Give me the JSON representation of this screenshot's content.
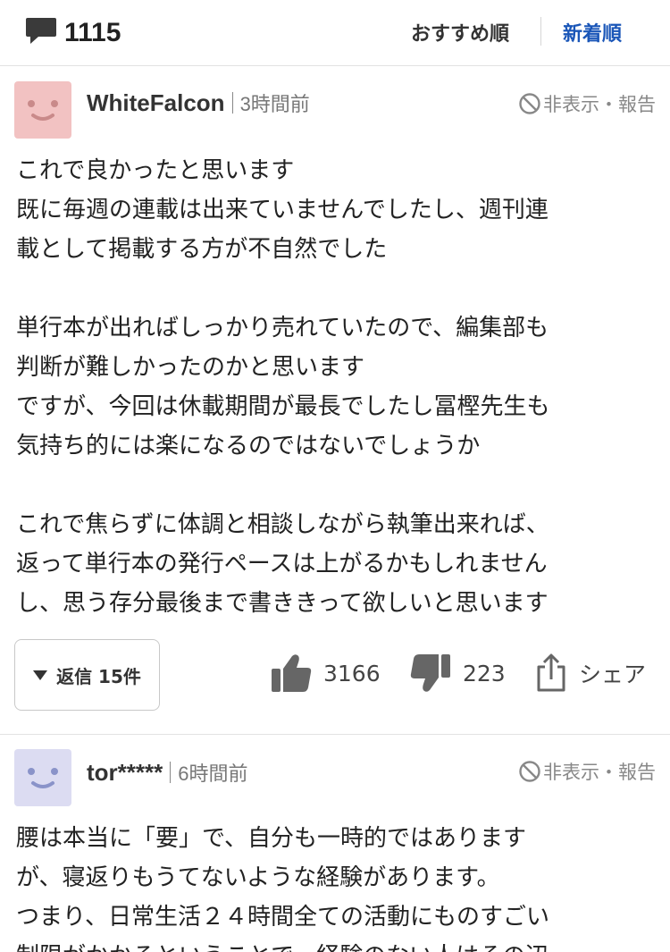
{
  "header": {
    "comment_count": "1115",
    "sort_recommended": "おすすめ順",
    "sort_newest": "新着順"
  },
  "comments": [
    {
      "user": "WhiteFalcon",
      "time": "3時間前",
      "report": "非表示・報告",
      "avatar_color": "#f2c2c2",
      "body": "これで良かったと思います\n既に毎週の連載は出来ていませんでしたし、週刊連\n載として掲載する方が不自然でした\n\n単行本が出ればしっかり売れていたので、編集部も\n判断が難しかったのかと思います\nですが、今回は休載期間が最長でしたし冨樫先生も\n気持ち的には楽になるのではないでしょうか\n\nこれで焦らずに体調と相談しながら執筆出来れば、\n返って単行本の発行ペースは上がるかもしれません\nし、思う存分最後まで書ききって欲しいと思います",
      "reply_label": "返信 15件",
      "likes": "3166",
      "dislikes": "223",
      "share": "シェア"
    },
    {
      "user": "tor*****",
      "time": "6時間前",
      "report": "非表示・報告",
      "avatar_color": "#dcdcf2",
      "body": "腰は本当に「要」で、自分も一時的ではあります\nが、寝返りもうてないような経験があります。\nつまり、日常生活２４時間全ての活動にものすごい\n制限がかかるということで、経験のない人はその辺"
    }
  ],
  "colors": {
    "accent_blue": "#1a56b8",
    "icon_gray": "#888888",
    "divider": "#e2e2e2"
  }
}
